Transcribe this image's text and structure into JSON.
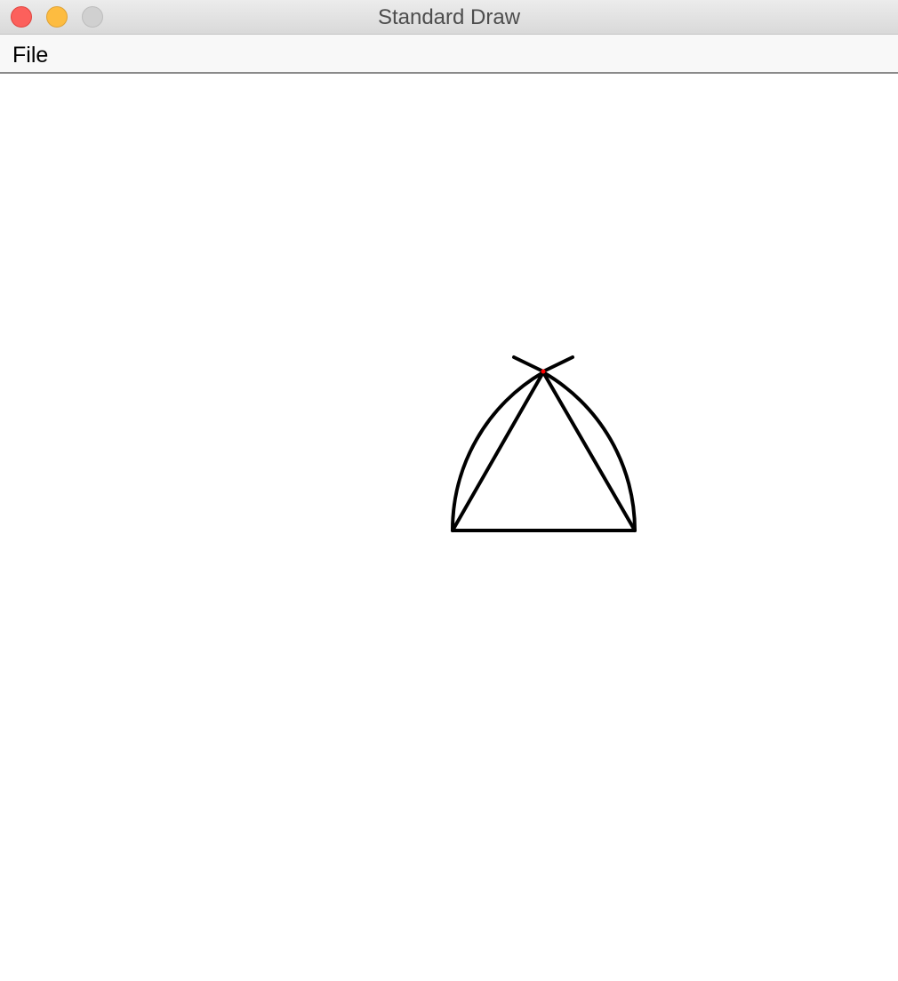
{
  "window": {
    "title": "Standard Draw"
  },
  "menubar": {
    "items": [
      {
        "label": "File"
      }
    ]
  },
  "canvas": {
    "background": "#ffffff",
    "stroke_color": "#000000",
    "point_color": "#ff0000"
  }
}
